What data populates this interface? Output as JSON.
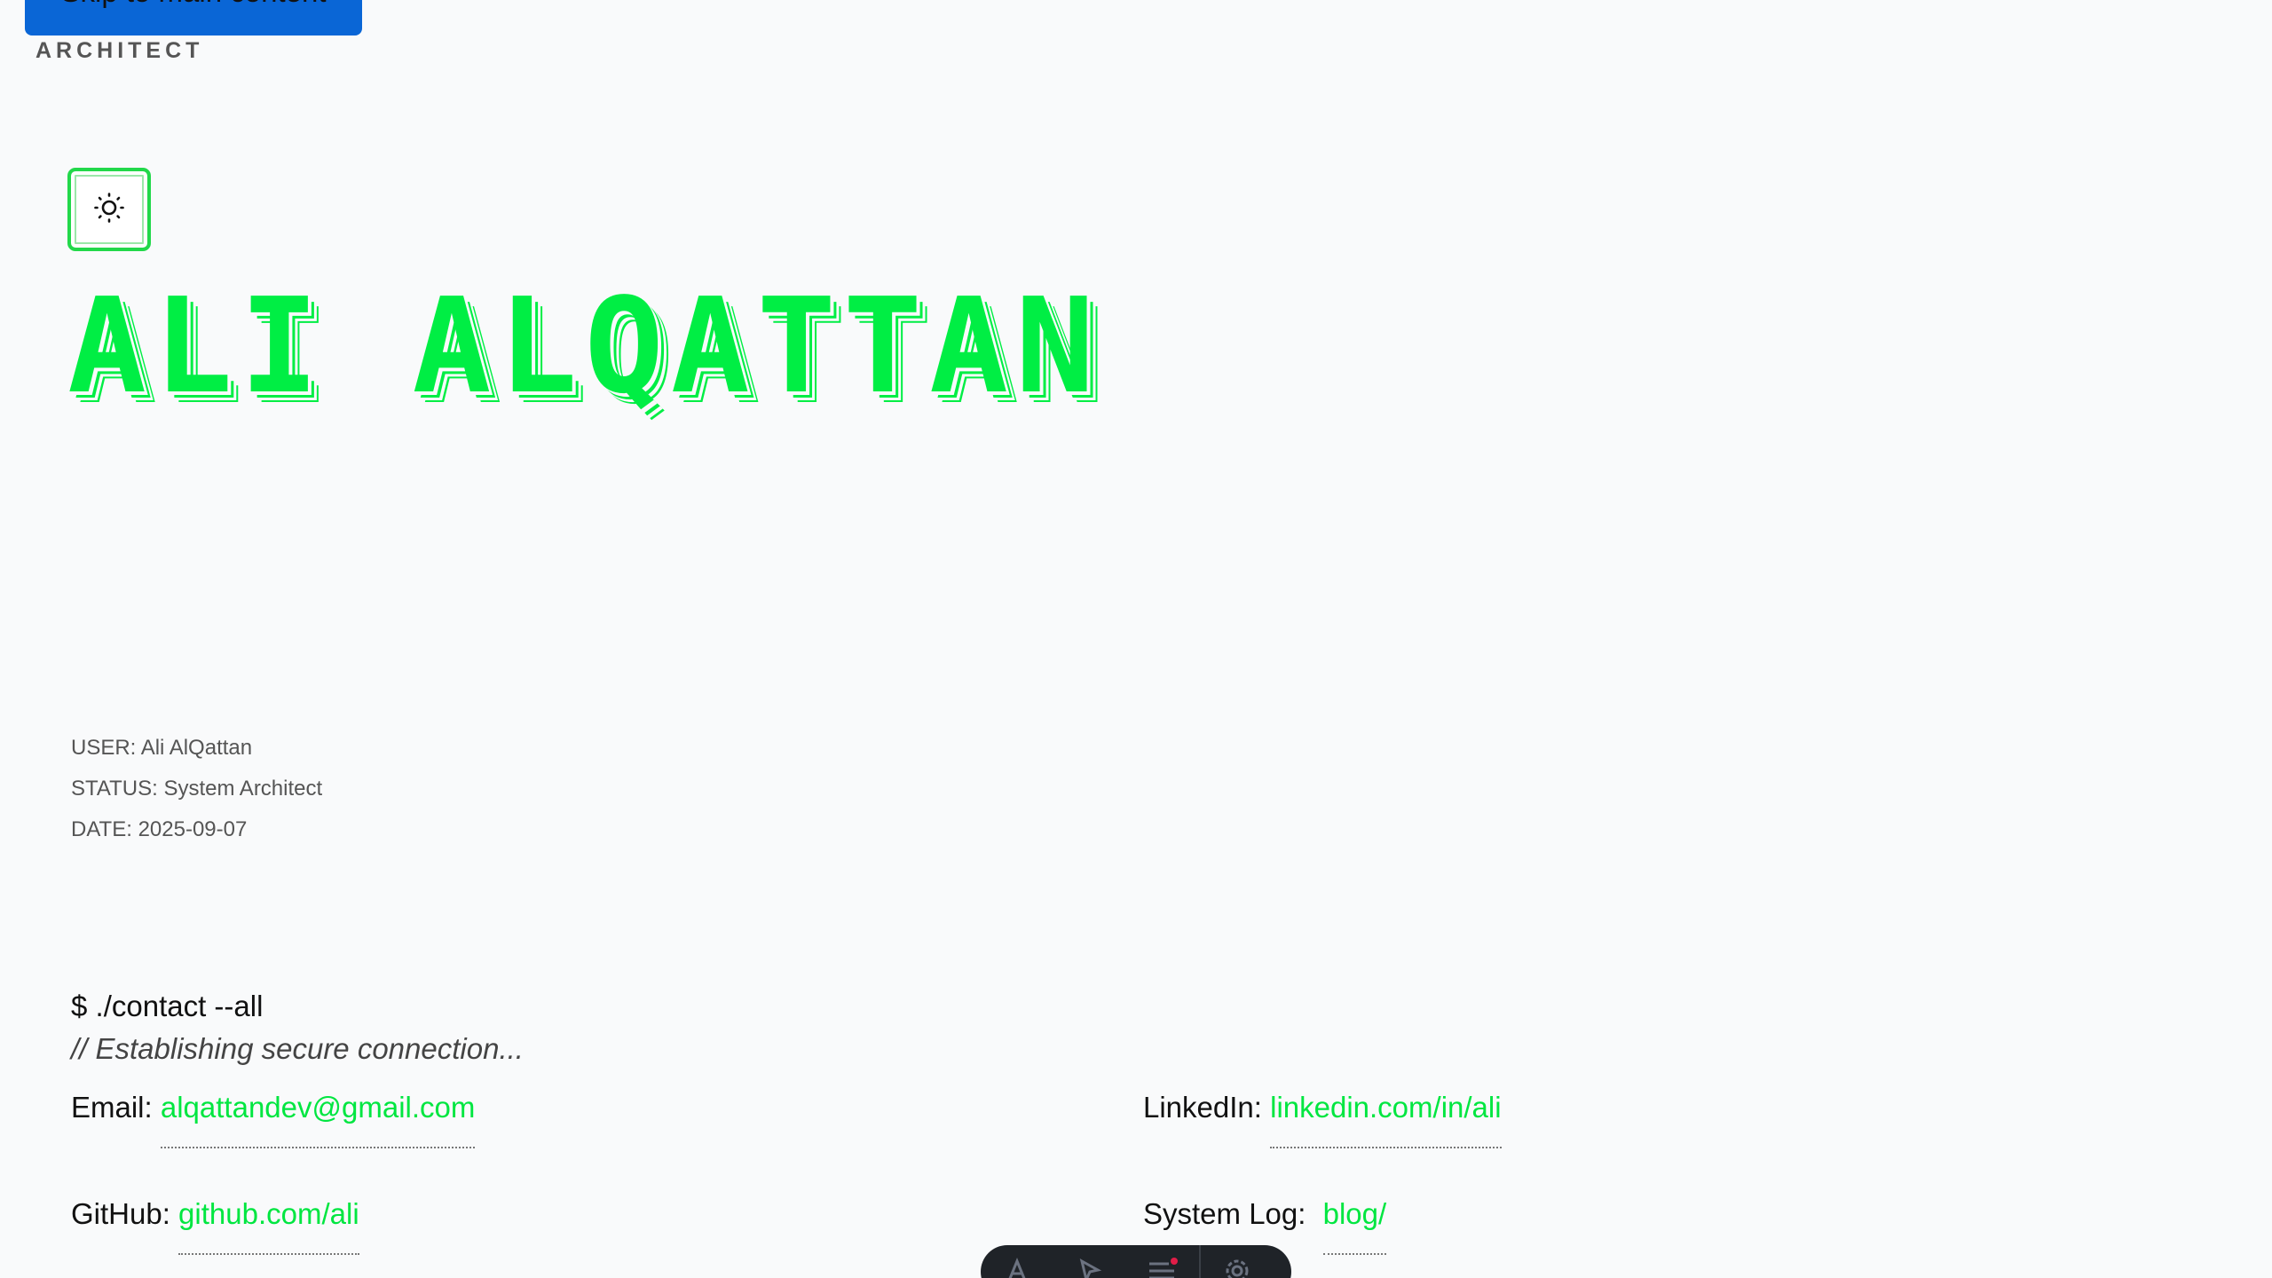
{
  "skip_link": {
    "label": "Skip to main content"
  },
  "brand": {
    "tag": "ARCHITECT"
  },
  "theme_toggle": {
    "icon": "sun-icon"
  },
  "hero": {
    "title": "Ali AlQattan"
  },
  "system_info": {
    "user": "USER: Ali AlQattan",
    "status": "STATUS: System Architect",
    "date": "DATE: 2025-09-07"
  },
  "terminal": {
    "command": "$ ./contact --all",
    "comment": "// Establishing secure connection..."
  },
  "contacts": {
    "email": {
      "label": "Email:",
      "value": "alqattandev@gmail.com"
    },
    "linkedin": {
      "label": "LinkedIn:",
      "value": "linkedin.com/in/ali"
    },
    "github": {
      "label": "GitHub:",
      "value": "github.com/ali"
    },
    "system_log": {
      "label": "System Log:",
      "value": "blog/"
    }
  },
  "dock": {
    "items": [
      "a-icon",
      "cursor-icon",
      "list-icon",
      "gear-icon"
    ]
  },
  "colors": {
    "accent": "#00ee44",
    "background": "#f9fafb",
    "skip_link_bg": "#0a66d6",
    "dock_bg": "#1f2328"
  }
}
